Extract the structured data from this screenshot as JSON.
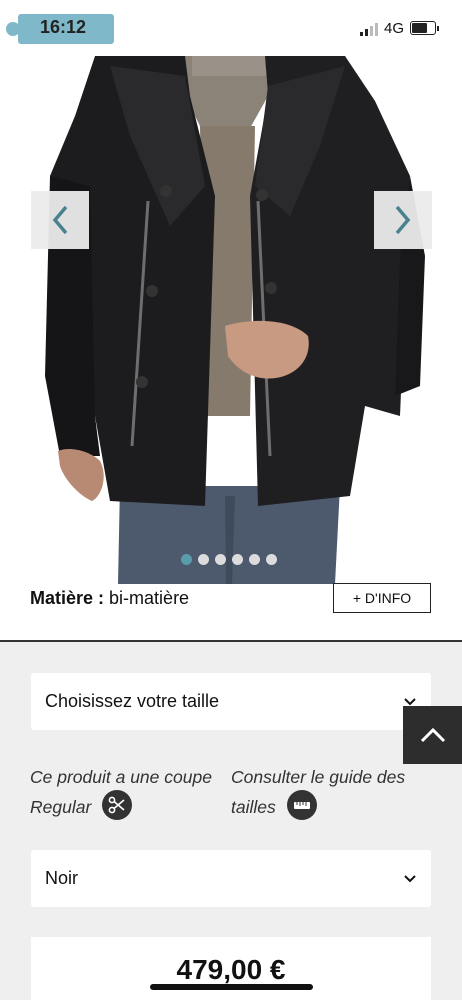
{
  "status_bar": {
    "time": "16:12",
    "network": "4G"
  },
  "carousel": {
    "slides": 6,
    "active_index": 0,
    "prev_icon": "chevron-left-icon",
    "next_icon": "chevron-right-icon"
  },
  "product": {
    "material_label": "Matière :",
    "material_value": "bi-matière",
    "info_button": "+ D'INFO"
  },
  "options": {
    "size_select": "Choisissez votre taille",
    "fit_note": "Ce produit a une coupe Regular",
    "size_guide": "Consulter le guide des tailles",
    "color_select": "Noir"
  },
  "price": "479,00 €",
  "colors": {
    "accent": "#5a9cab",
    "panel_bg": "#efefef",
    "dark": "#2d2d2d"
  }
}
